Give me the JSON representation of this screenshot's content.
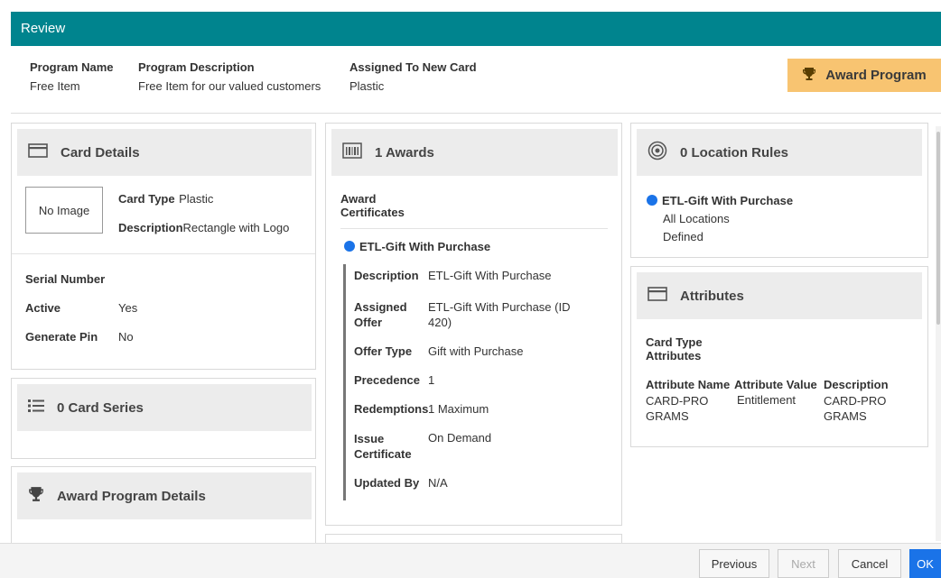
{
  "header": {
    "title": "Review"
  },
  "summary": {
    "program_name_label": "Program Name",
    "program_name": "Free Item",
    "program_description_label": "Program Description",
    "program_description": "Free Item for our valued customers",
    "assigned_label": "Assigned To New Card",
    "assigned_value": "Plastic",
    "award_button": "Award Program"
  },
  "card_details": {
    "title": "Card Details",
    "no_image": "No Image",
    "card_type_label": "Card Type",
    "card_type": "Plastic",
    "description_label": "Description",
    "description": "Rectangle with Logo",
    "serial_label": "Serial Number",
    "active_label": "Active",
    "active_value": "Yes",
    "pin_label": "Generate Pin",
    "pin_value": "No"
  },
  "card_series": {
    "title": "0 Card Series"
  },
  "award_program_details": {
    "title": "Award Program Details"
  },
  "awards": {
    "title": "1 Awards",
    "section_label_1": "Award",
    "section_label_2": "Certificates",
    "item_name": "ETL-Gift With Purchase",
    "rows": [
      {
        "label": "Description",
        "value": "ETL-Gift With Purchase"
      },
      {
        "label": "Assigned Offer",
        "value": "ETL-Gift With Purchase (ID 420)"
      },
      {
        "label": "Offer Type",
        "value": "Gift with Purchase"
      },
      {
        "label": "Precedence",
        "value": "1"
      },
      {
        "label": "Redemptions",
        "value": "1 Maximum"
      },
      {
        "label": "Issue Certificate",
        "value": "On Demand"
      },
      {
        "label": "Updated By",
        "value": "N/A"
      }
    ]
  },
  "location_rules": {
    "title": "0 Location Rules",
    "item_name": "ETL-Gift With Purchase",
    "line1": "All Locations",
    "line2": "Defined"
  },
  "attributes": {
    "title": "Attributes",
    "section_1": "Card Type",
    "section_2": "Attributes",
    "headers": [
      "Attribute Name",
      "Attribute Value",
      "Description"
    ],
    "row": [
      "CARD-PROGRAMS",
      "Entitlement",
      "CARD-PROGRAMS"
    ]
  },
  "footer": {
    "previous": "Previous",
    "next": "Next",
    "cancel": "Cancel",
    "ok": "OK"
  }
}
